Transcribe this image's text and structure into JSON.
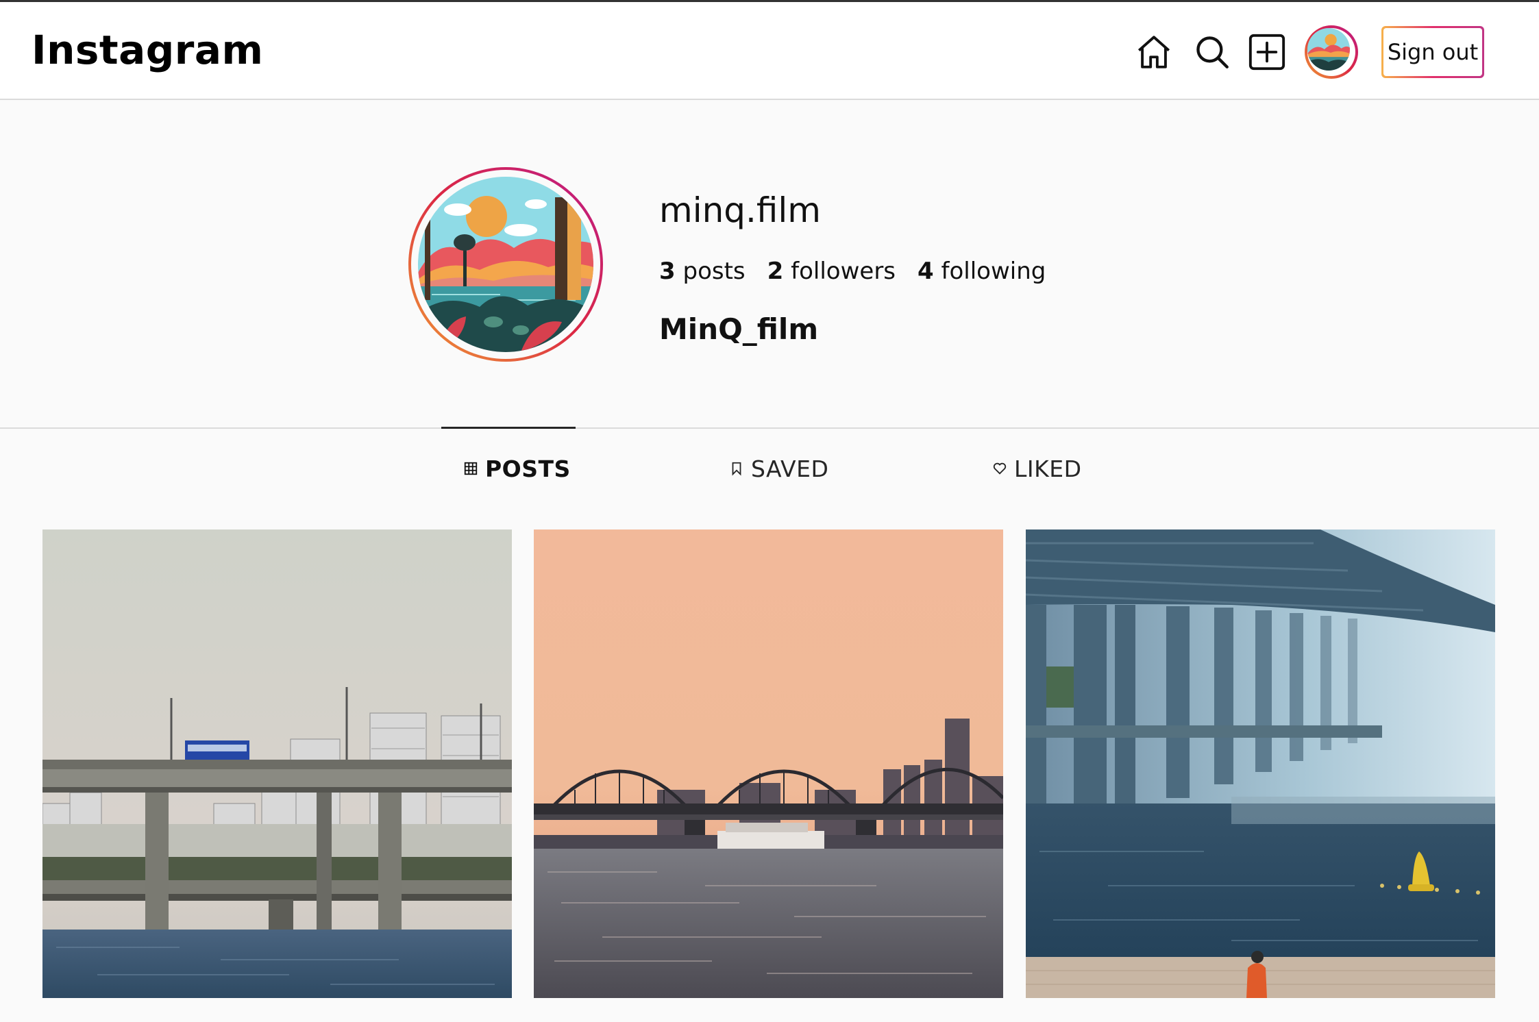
{
  "header": {
    "logo": "Instagram",
    "sign_out_label": "Sign out"
  },
  "nav_icons": [
    "home-icon",
    "search-icon",
    "new-post-icon",
    "profile-avatar"
  ],
  "profile": {
    "username": "minq.film",
    "posts_count": "3",
    "posts_label": "posts",
    "followers_count": "2",
    "followers_label": "followers",
    "following_count": "4",
    "following_label": "following",
    "full_name": "MinQ_film"
  },
  "tabs": [
    {
      "label": "POSTS",
      "icon": "grid-icon",
      "active": true
    },
    {
      "label": "SAVED",
      "icon": "bookmark-icon",
      "active": false
    },
    {
      "label": "LIKED",
      "icon": "heart-icon",
      "active": false
    }
  ],
  "posts": [
    {
      "subject": "bridge-with-bus-and-city"
    },
    {
      "subject": "sunset-arched-bridge-ferry"
    },
    {
      "subject": "misty-bridge-with-buoy"
    }
  ],
  "colors": {
    "accent_gradient": [
      "#f09433",
      "#e6683c",
      "#dc2743",
      "#cc2366",
      "#bc1888"
    ],
    "background": "#fafafa",
    "text": "#111111"
  }
}
